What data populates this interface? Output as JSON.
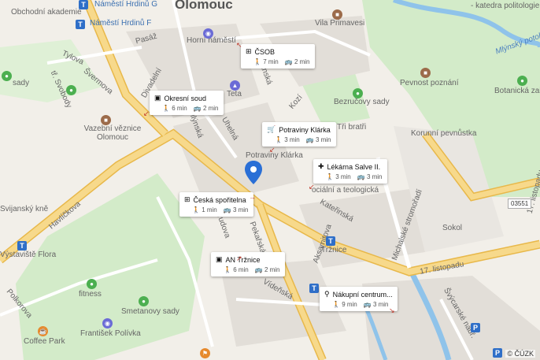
{
  "map": {
    "city": "Olomouc",
    "copyright": "© ČÚZK",
    "road_badge": "03551",
    "labels": {
      "obchodni_akademie": "Obchodní akademie",
      "namesti_hrdinu_g": "Náměstí Hrdinů G",
      "namesti_hrdinu_f": "Náměstí Hrdinů F",
      "katedra": "- katedra politologie",
      "mlynsky": "Mlýnský potok",
      "pasaz": "Pasáž",
      "horni_namesti": "Horní náměstí",
      "vila_primavesi": "Vila Primavesi",
      "tylova": "Tylova",
      "divadelni": "Divadelní",
      "pevnost_poznani": "Pevnost poznání",
      "botanicka": "Botanická zahra",
      "sady": "sady",
      "tr_svobody": "tř. Svobody",
      "svermova": "Švermova",
      "teta": "Teta",
      "bezrucovy_sady": "Bezručovy sady",
      "kozi": "Kozí",
      "panska": "Panská",
      "vazebni": "Vazební věznice Olomouc",
      "mlynska": "Mlýnská",
      "uhelna": "Uhelná",
      "tri_bratri": "Tři bratři",
      "korunni": "Korunní pevnůstka",
      "potraviny_label": "Potraviny Klárka",
      "havlickova": "Havlíčkova",
      "svijansky": "Svijanský kně",
      "socialni": "ociální a teologická",
      "katerinska": "Kateřinská",
      "michalske": "Michalské stromořadí",
      "listopadu_17": "17. listopadu",
      "sokol": "Sokol",
      "vystaviste": "Výstaviště Flora",
      "nerudova": "Nerudova",
      "pekarska": "Pekařská",
      "aksamitova": "Aksamitova",
      "trznice": "Tržnice",
      "fitness": "fitness",
      "smetanovy": "Smetanovy sady",
      "videnska": "Vídeňská",
      "polkorova": "Polkorova",
      "coffee_park": "Coffee Park",
      "frantisek": "František Polívka",
      "svykarske": "Švýcarské nábř.",
      "listopadu_17b": "17. listopadu"
    },
    "stops": [
      {
        "name": "ČSOB",
        "icon": "atm-icon",
        "walk": "7 min",
        "transit": "2 min"
      },
      {
        "name": "Okresní soud",
        "icon": "bus-icon",
        "walk": "6 min",
        "transit": "2 min"
      },
      {
        "name": "Potraviny Klárka",
        "icon": "cart-icon",
        "walk": "3 min",
        "transit": "3 min"
      },
      {
        "name": "Lékárna Salve II.",
        "icon": "pharmacy-icon",
        "walk": "3 min",
        "transit": "3 min"
      },
      {
        "name": "Česká spořitelna",
        "icon": "atm-icon",
        "walk": "1 min",
        "transit": "3 min"
      },
      {
        "name": "AN Tržnice",
        "icon": "bus-icon",
        "walk": "6 min",
        "transit": "2 min"
      },
      {
        "name": "Nákupní centrum...",
        "icon": "bike-icon",
        "walk": "9 min",
        "transit": "3 min"
      }
    ],
    "colors": {
      "road": "#f7d98b",
      "road_edge": "#e8b84a",
      "water": "#8fc3ea",
      "park": "#d3ebc9",
      "pin": "#2a6fd6",
      "block": "#e0dcd6"
    }
  }
}
